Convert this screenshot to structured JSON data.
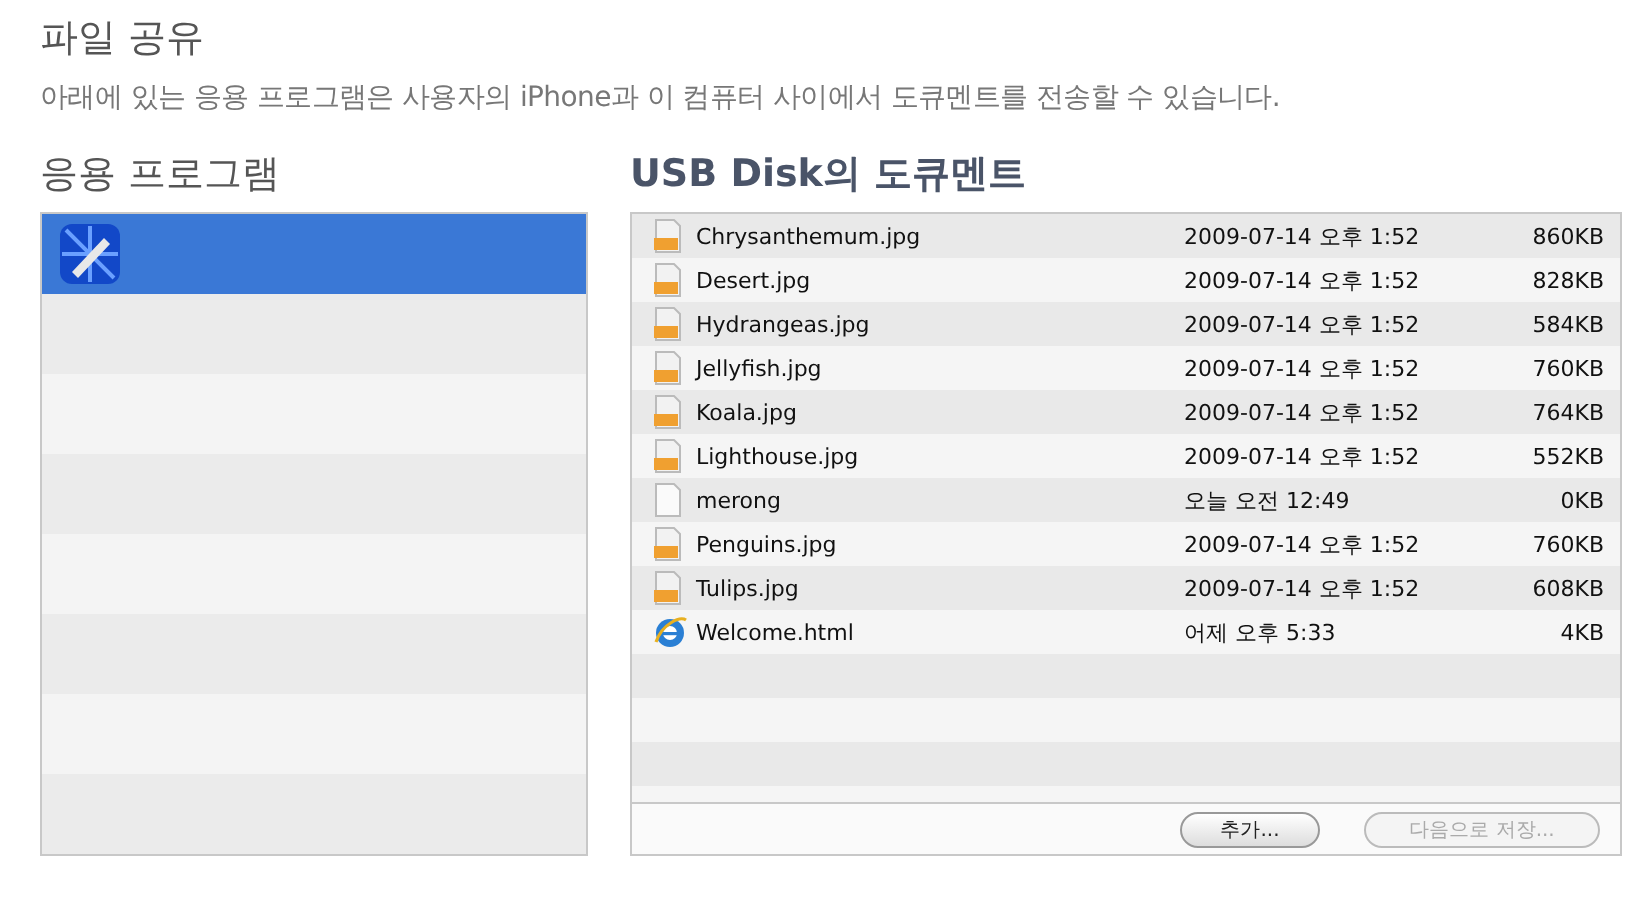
{
  "title": "파일 공유",
  "description": "아래에 있는 응용 프로그램은 사용자의 iPhone과 이 컴퓨터 사이에서 도큐멘트를 전송할 수 있습니다.",
  "apps_heading": "응용 프로그램",
  "documents_heading": "USB Disk의 도큐멘트",
  "apps": [
    {
      "selected": true
    }
  ],
  "documents": [
    {
      "kind": "jpg",
      "name": "Chrysanthemum.jpg",
      "date": "2009-07-14 오후 1:52",
      "size": "860KB"
    },
    {
      "kind": "jpg",
      "name": "Desert.jpg",
      "date": "2009-07-14 오후 1:52",
      "size": "828KB"
    },
    {
      "kind": "jpg",
      "name": "Hydrangeas.jpg",
      "date": "2009-07-14 오후 1:52",
      "size": "584KB"
    },
    {
      "kind": "jpg",
      "name": "Jellyfish.jpg",
      "date": "2009-07-14 오후 1:52",
      "size": "760KB"
    },
    {
      "kind": "jpg",
      "name": "Koala.jpg",
      "date": "2009-07-14 오후 1:52",
      "size": "764KB"
    },
    {
      "kind": "jpg",
      "name": "Lighthouse.jpg",
      "date": "2009-07-14 오후 1:52",
      "size": "552KB"
    },
    {
      "kind": "file",
      "name": "merong",
      "date": "오늘 오전 12:49",
      "size": "0KB"
    },
    {
      "kind": "jpg",
      "name": "Penguins.jpg",
      "date": "2009-07-14 오후 1:52",
      "size": "760KB"
    },
    {
      "kind": "jpg",
      "name": "Tulips.jpg",
      "date": "2009-07-14 오후 1:52",
      "size": "608KB"
    },
    {
      "kind": "html",
      "name": "Welcome.html",
      "date": "어제 오후 5:33",
      "size": "4KB"
    }
  ],
  "buttons": [
    {
      "label": "추가...",
      "disabled": false
    },
    {
      "label": "다음으로 저장...",
      "disabled": true
    }
  ]
}
